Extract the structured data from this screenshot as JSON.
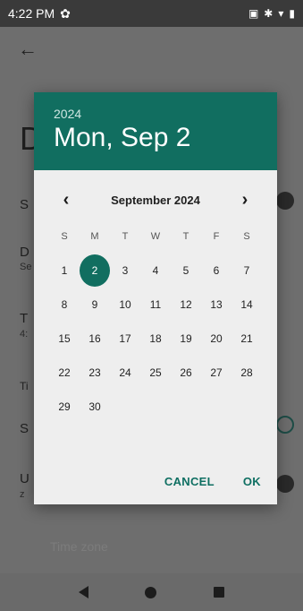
{
  "status_bar": {
    "time": "4:22 PM",
    "icons": [
      "gear-icon",
      "screenshot-icon",
      "bluetooth-icon",
      "wifi-icon",
      "battery-icon"
    ]
  },
  "background": {
    "back_icon": "arrow-left-icon",
    "title": "D",
    "rows": [
      {
        "label": "S"
      },
      {
        "label": "D",
        "sub": "Se"
      },
      {
        "label": "T",
        "sub": "4:"
      },
      {
        "label": "Ti"
      },
      {
        "label": "S"
      },
      {
        "label": "U",
        "sub": "z"
      }
    ],
    "faded_text": "Time zone"
  },
  "dialog": {
    "year": "2024",
    "selected_date": "Mon, Sep 2",
    "month_label": "September 2024",
    "prev_icon": "chevron-left-icon",
    "next_icon": "chevron-right-icon",
    "weekdays": [
      "S",
      "M",
      "T",
      "W",
      "T",
      "F",
      "S"
    ],
    "days": [
      "1",
      "2",
      "3",
      "4",
      "5",
      "6",
      "7",
      "8",
      "9",
      "10",
      "11",
      "12",
      "13",
      "14",
      "15",
      "16",
      "17",
      "18",
      "19",
      "20",
      "21",
      "22",
      "23",
      "24",
      "25",
      "26",
      "27",
      "28",
      "29",
      "30"
    ],
    "selected_day": "2",
    "cancel_label": "CANCEL",
    "ok_label": "OK",
    "accent_color": "#116e60"
  },
  "nav_bar": {
    "icons": [
      "back-icon",
      "home-icon",
      "recents-icon"
    ]
  }
}
